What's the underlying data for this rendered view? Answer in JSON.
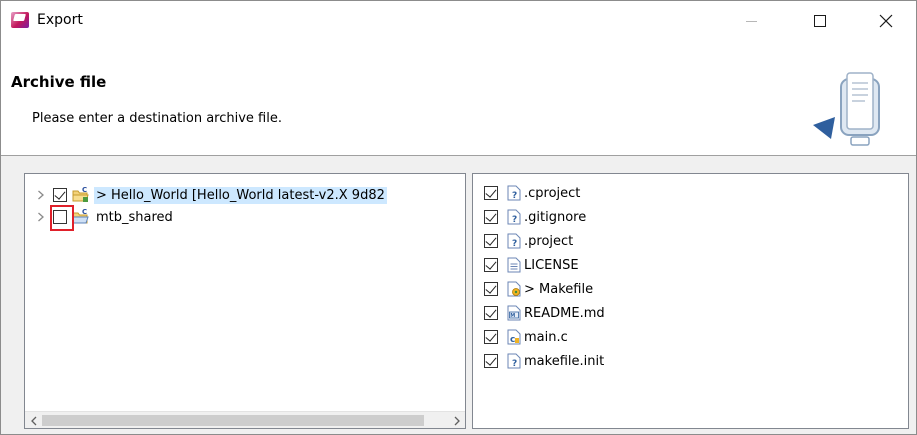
{
  "window": {
    "title": "Export",
    "icon": "export-wizard-icon",
    "controls": [
      "minimize",
      "maximize",
      "close"
    ]
  },
  "banner": {
    "title": "Archive file",
    "description": "Please enter a destination archive file.",
    "graphic_icon": "archive-export-graphic-icon"
  },
  "left_tree": {
    "items": [
      {
        "label": "> Hello_World [Hello_World latest-v2.X 9d82",
        "checked": true,
        "selected": true,
        "icon": "c-project-folder-icon"
      },
      {
        "label": "mtb_shared",
        "checked": false,
        "selected": false,
        "icon": "c-project-folder-icon",
        "highlighted": true
      }
    ]
  },
  "right_list": {
    "items": [
      {
        "label": ".cproject",
        "checked": true,
        "icon": "unknown-file-icon"
      },
      {
        "label": ".gitignore",
        "checked": true,
        "icon": "unknown-file-icon"
      },
      {
        "label": ".project",
        "checked": true,
        "icon": "unknown-file-icon"
      },
      {
        "label": "LICENSE",
        "checked": true,
        "icon": "text-file-icon"
      },
      {
        "label": "> Makefile",
        "checked": true,
        "icon": "makefile-icon"
      },
      {
        "label": "README.md",
        "checked": true,
        "icon": "markdown-file-icon"
      },
      {
        "label": "main.c",
        "checked": true,
        "icon": "c-source-file-icon"
      },
      {
        "label": "makefile.init",
        "checked": true,
        "icon": "unknown-file-icon"
      }
    ]
  },
  "colors": {
    "selection": "#cde8ff",
    "highlight_border": "#e0202a",
    "pane_border": "#828790",
    "dialog_bg": "#f0f0f0"
  }
}
